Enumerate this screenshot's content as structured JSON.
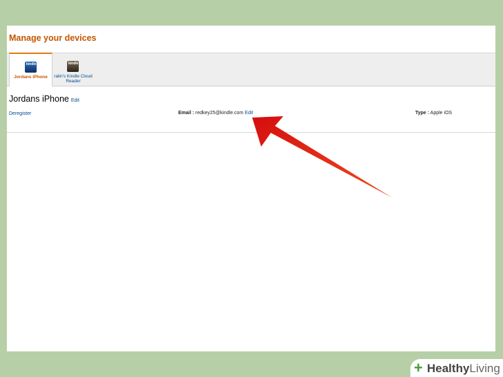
{
  "page": {
    "title": "Manage your devices"
  },
  "tabs": [
    {
      "label": "Jordans iPhone",
      "icon_text": "kindle",
      "active": true
    },
    {
      "label": "ralin's Kindle Cloud Reader",
      "icon_text": "kindle",
      "active": false
    }
  ],
  "device": {
    "name": "Jordans iPhone",
    "edit_label": "Edit",
    "deregister_label": "Deregister",
    "email_label": "Email :",
    "email_value": "redkey25@kindle.com",
    "email_edit_label": "Edit",
    "type_label": "Type :",
    "type_value": "Apple iOS"
  },
  "brand": {
    "first": "Healthy",
    "second": "Living"
  },
  "colors": {
    "background": "#b7cfa6",
    "title": "#c45500",
    "link": "#004b91",
    "arrow": "#e01010"
  }
}
